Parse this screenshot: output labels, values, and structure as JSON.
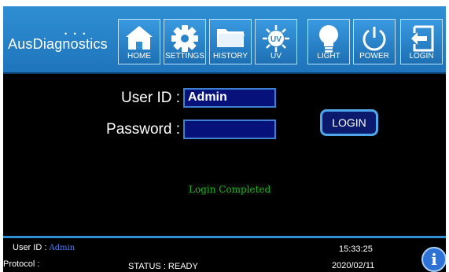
{
  "brand": {
    "name": "AusDiagnostics"
  },
  "nav": [
    {
      "label": "HOME",
      "icon": "home-icon"
    },
    {
      "label": "SETTINGS",
      "icon": "gear-icon"
    },
    {
      "label": "HISTORY",
      "icon": "folder-icon"
    },
    {
      "label": "UV",
      "icon": "uv-icon"
    },
    {
      "label": "LIGHT",
      "icon": "lightbulb-icon"
    },
    {
      "label": "POWER",
      "icon": "power-icon"
    },
    {
      "label": "LOGIN",
      "icon": "login-icon"
    }
  ],
  "form": {
    "user_id_label": "User ID :",
    "user_id_value": "Admin",
    "password_label": "Password :",
    "password_value": "",
    "login_button": "LOGIN",
    "message": "Login Completed"
  },
  "footer": {
    "user_id_label": "User ID :",
    "user_id_value": "Admin",
    "protocol_label": "Protocol :",
    "status": "STATUS : READY",
    "time": "15:33:25",
    "date": "2020/02/11"
  },
  "colors": {
    "header": "#2f8fd2",
    "field": "#06127a",
    "message": "#1fb11f"
  }
}
